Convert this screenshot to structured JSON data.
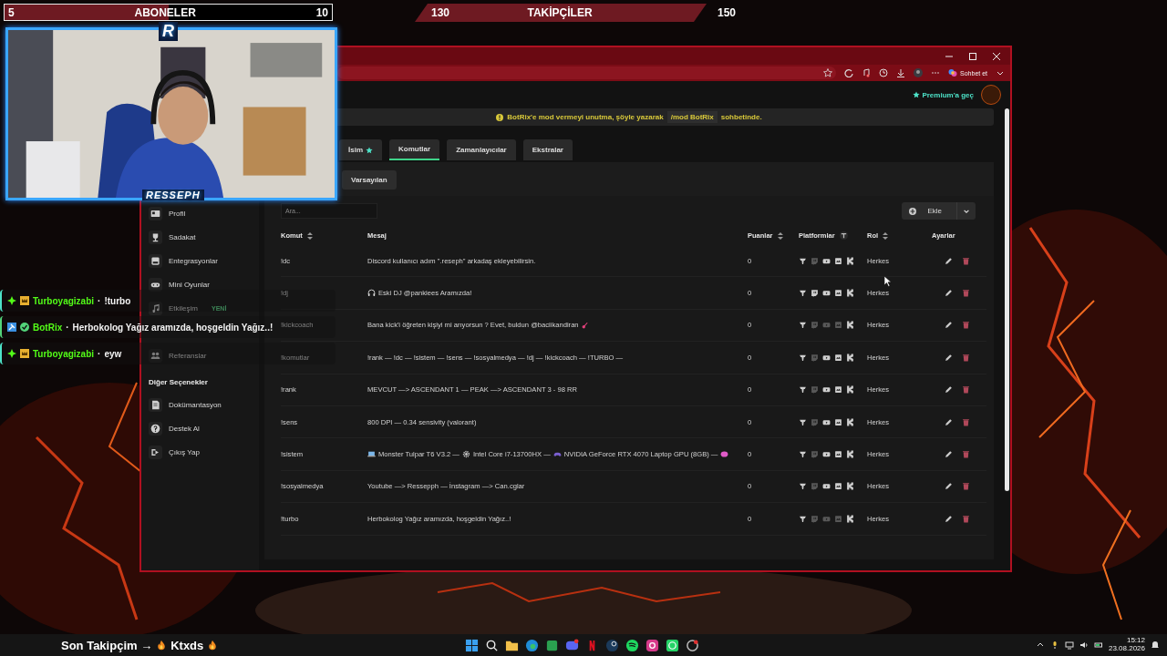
{
  "overlay": {
    "subscribers": {
      "current": "5",
      "label": "ABONELER",
      "goal": "10",
      "level": 0.5
    },
    "followers": {
      "current": "130",
      "label": "TAKİPÇİLER",
      "goal": "150"
    }
  },
  "webcam": {
    "kind": "picture",
    "logo": "R",
    "name": "RESSEPH"
  },
  "browser": {
    "toolbar": {
      "chat_button": "Sohbet et"
    },
    "header": {
      "premium": "Premium'a geç"
    },
    "notice": {
      "text": "BotRix'e mod vermeyi unutma, şöyle yazarak",
      "code": "/mod BotRix",
      "suffix": "sohbetinde."
    },
    "sidebar": {
      "items": [
        {
          "label": "Profil"
        },
        {
          "label": "Sadakat"
        },
        {
          "label": "Entegrasyonlar"
        },
        {
          "label": "Mini Oyunlar"
        },
        {
          "label": "Etkileşim",
          "badge": "YENİ"
        },
        {
          "label": "Referanslar"
        }
      ],
      "section": "Diğer Seçenekler",
      "more_items": [
        {
          "label": "Dokümantasyon"
        },
        {
          "label": "Destek Al"
        },
        {
          "label": "Çıkış Yap"
        }
      ]
    },
    "tabs": [
      {
        "label": "İsim",
        "star": true,
        "selected": false
      },
      {
        "label": "Komutlar",
        "selected": true
      },
      {
        "label": "Zamanlayıcılar",
        "selected": false
      },
      {
        "label": "Ekstralar",
        "selected": false
      }
    ],
    "subtabs": [
      {
        "label": "Varsayılan",
        "selected": true
      }
    ],
    "search": {
      "placeholder": "Ara..."
    },
    "add_button": "Ekle",
    "table": {
      "columns": [
        {
          "label": "Komut",
          "kind": "sort"
        },
        {
          "label": "Mesaj",
          "kind": "plain"
        },
        {
          "label": "Puanlar",
          "kind": "sort"
        },
        {
          "label": "Platformlar",
          "kind": "filter"
        },
        {
          "label": "Rol",
          "kind": "sort"
        },
        {
          "label": "Ayarlar",
          "kind": "plain"
        }
      ],
      "rows": [
        {
          "command": "!dc",
          "message": [
            {
              "text": "Discord kullanıcı adım \".reseph\" arkadaş ekleyebilirsin."
            }
          ],
          "points": "0",
          "platforms_on": [
            true,
            false,
            true,
            true,
            true
          ],
          "role": "Herkes"
        },
        {
          "command": "!dj",
          "message": [
            {
              "kind": "emoji"
            },
            {
              "text": "Eski DJ @pankiees Aramızda!"
            }
          ],
          "points": "0",
          "platforms_on": [
            true,
            true,
            true,
            true,
            true
          ],
          "role": "Herkes"
        },
        {
          "command": "!kickcoach",
          "message": [
            {
              "text": "Bana kick'i öğreten kişiyi mi arıyorsun ? Evet, buldun @baciikandiran"
            },
            {
              "kind": "emoji"
            }
          ],
          "points": "0",
          "platforms_on": [
            true,
            false,
            false,
            false,
            true
          ],
          "role": "Herkes"
        },
        {
          "command": "!komutlar",
          "message": [
            {
              "text": "!rank — !dc — !sistem — !sens — !sosyalmedya — !dj — !kickcoach — !TURBO —"
            }
          ],
          "points": "0",
          "platforms_on": [
            true,
            false,
            true,
            true,
            true
          ],
          "role": "Herkes"
        },
        {
          "command": "!rank",
          "message": [
            {
              "text": "MEVCUT —> ASCENDANT 1 — PEAK —> ASCENDANT 3 - 98 RR"
            }
          ],
          "points": "0",
          "platforms_on": [
            true,
            false,
            true,
            true,
            true
          ],
          "role": "Herkes"
        },
        {
          "command": "!sens",
          "message": [
            {
              "text": "800 DPI — 0.34 sensivity (valorant)"
            }
          ],
          "points": "0",
          "platforms_on": [
            true,
            false,
            true,
            true,
            true
          ],
          "role": "Herkes"
        },
        {
          "command": "!sistem",
          "message": [
            {
              "kind": "emoji"
            },
            {
              "text": "Monster Tulpar T6 V3.2 —"
            },
            {
              "kind": "emoji"
            },
            {
              "text": "Intel Core i7-13700HX —"
            },
            {
              "kind": "emoji"
            },
            {
              "text": "NVIDIA GeForce RTX 4070 Laptop GPU (8GB) —"
            },
            {
              "kind": "emoji"
            }
          ],
          "points": "0",
          "platforms_on": [
            true,
            false,
            true,
            true,
            true
          ],
          "role": "Herkes"
        },
        {
          "command": "!sosyalmedya",
          "message": [
            {
              "text": "Youtube —> Ressepph — İnstagram —> Can.cglar"
            }
          ],
          "points": "0",
          "platforms_on": [
            true,
            false,
            true,
            true,
            true
          ],
          "role": "Herkes"
        },
        {
          "command": "!turbo",
          "message": [
            {
              "text": "Herbokolog Yağız aramızda, hoşgeldin Yağız..!"
            }
          ],
          "points": "0",
          "platforms_on": [
            true,
            false,
            false,
            false,
            true
          ],
          "role": "Herkes"
        }
      ]
    }
  },
  "chat": [
    {
      "kind": "viewer",
      "user": "Turboyagizabi",
      "separator": "·",
      "message": "!turbo"
    },
    {
      "kind": "bot",
      "user": "BotRix",
      "separator": "·",
      "message": "Herbokolog Yağız aramızda, hoşgeldin Yağız..!"
    },
    {
      "kind": "viewer",
      "user": "Turboyagizabi",
      "separator": "·",
      "message": "eyw"
    }
  ],
  "taskbar": {
    "ticker": [
      {
        "text": "Son Takipçim →"
      },
      {
        "kind": "emoji"
      },
      {
        "text": "Ktxds"
      },
      {
        "kind": "emoji"
      }
    ],
    "time": "15:12",
    "date": "23.08.2026"
  }
}
